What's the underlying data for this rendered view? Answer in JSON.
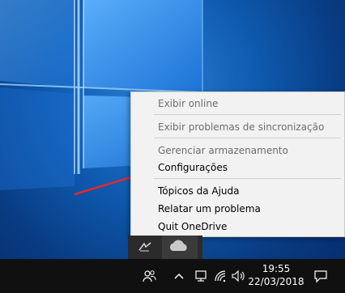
{
  "context_menu": {
    "items": [
      {
        "label": "Exibir online",
        "enabled": false
      },
      {
        "label": "Exibir problemas de sincronização",
        "enabled": false
      },
      {
        "label": "Gerenciar armazenamento",
        "enabled": false
      },
      {
        "label": "Configurações",
        "enabled": true
      },
      {
        "label": "Tópicos da Ajuda",
        "enabled": true
      },
      {
        "label": "Relatar um problema",
        "enabled": true
      },
      {
        "label": "Quit OneDrive",
        "enabled": true
      }
    ]
  },
  "taskbar": {
    "time": "19:55",
    "date": "22/03/2018"
  },
  "icons": {
    "people": "people-icon",
    "chevron": "chevron-up-icon",
    "network": "network-icon",
    "wifi": "wifi-icon",
    "volume": "volume-icon",
    "notifications": "action-center-icon",
    "onedrive": "onedrive-cloud-icon",
    "tray_app": "tray-app-icon"
  },
  "colors": {
    "annotation_arrow": "#e8272e",
    "menu_background": "#f2f2f2",
    "taskbar": "#101010"
  }
}
